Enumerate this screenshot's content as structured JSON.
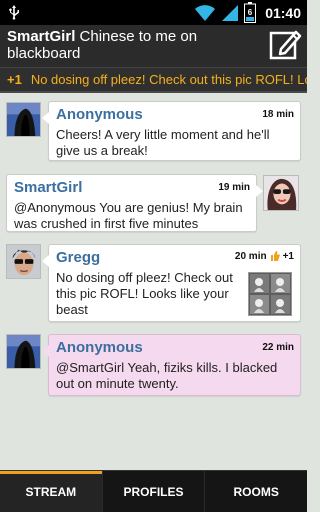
{
  "status": {
    "time": "01:40",
    "icons": [
      "usb-icon",
      "wifi-icon",
      "signal-icon",
      "battery-icon"
    ],
    "battery": "6"
  },
  "header": {
    "user": "SmartGirl",
    "title": "Chinese to me on blackboard",
    "compose_icon": "compose-icon"
  },
  "notice": {
    "count": "+1",
    "text": "No dosing off pleez! Check out this pic ROFL! Looks like your beast"
  },
  "posts": [
    {
      "name": "Anonymous",
      "time": "18 min",
      "text": "Cheers! A very little moment and he'll give us a break!",
      "side": "left",
      "avatar": "hooded-figure"
    },
    {
      "name": "SmartGirl",
      "time": "19 min",
      "text": "@Anonymous You are genius! My brain was crushed in first five minutes",
      "side": "right",
      "avatar": "girl-sunglasses"
    },
    {
      "name": "Gregg",
      "time": "20 min",
      "plus": "+1",
      "text": "No dosing off pleez! Check out this pic ROFL! Looks like your beast",
      "side": "left",
      "avatar": "man-sunglasses"
    },
    {
      "name": "Anonymous",
      "time": "22 min",
      "text": "@SmartGirl Yeah, fiziks kills. I blacked out on minute twenty.",
      "side": "left",
      "avatar": "hooded-figure"
    }
  ],
  "tabs": [
    {
      "label": "STREAM",
      "active": true
    },
    {
      "label": "PROFILES",
      "active": false
    },
    {
      "label": "ROOMS",
      "active": false
    }
  ],
  "colors": {
    "accent": "#f2a11a",
    "name": "#3c6fa0",
    "highlight_bubble": "#f5d9ee",
    "background": "#dfe4de"
  }
}
